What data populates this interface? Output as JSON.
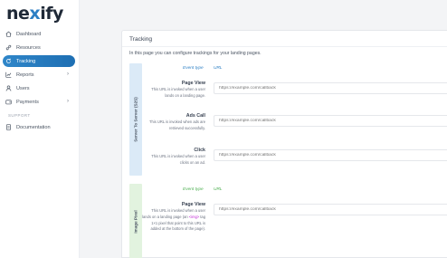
{
  "brand": {
    "logo_prefix": "ne",
    "logo_x": "x",
    "logo_suffix": "ify"
  },
  "sidebar": {
    "items": [
      {
        "label": "Dashboard",
        "icon": "home-icon"
      },
      {
        "label": "Resources",
        "icon": "link-icon"
      },
      {
        "label": "Tracking",
        "icon": "refresh-icon",
        "active": true
      },
      {
        "label": "Reports",
        "icon": "chart-icon",
        "has_children": true
      },
      {
        "label": "Users",
        "icon": "user-icon"
      },
      {
        "label": "Payments",
        "icon": "wallet-icon",
        "has_children": true
      }
    ],
    "support_heading": "SUPPORT",
    "support_items": [
      {
        "label": "Documentation",
        "icon": "document-icon"
      }
    ]
  },
  "main": {
    "title": "Tracking",
    "description": "In this page you can configure trackings for your landing pages.",
    "groups": [
      {
        "label": "Server To Server (S2S)",
        "color": "#dbeaf7",
        "header": {
          "event_type": "Event type",
          "url": "URL"
        },
        "rows": [
          {
            "title": "Page View",
            "description": "This URL is invoked when a user lands on a landing page.",
            "placeholder": "https://example.com/callback"
          },
          {
            "title": "Ads Call",
            "description": "This URL is invoked when ads are retrieved successfully.",
            "placeholder": "https://example.com/callback"
          },
          {
            "title": "Click",
            "description": "This URL is invoked when a user clicks on an ad.",
            "placeholder": "https://example.com/callback"
          }
        ]
      },
      {
        "label": "Image Pixel",
        "color": "#e2f3df",
        "header": {
          "event_type": "Event type",
          "url": "URL"
        },
        "rows": [
          {
            "title": "Page View",
            "description_before": "This URL is invoked when a user lands on a landing page (an ",
            "description_highlight": "<img>",
            "description_after": " tag 1×1 pixel that point to this URL is added at the bottom of the page).",
            "placeholder": "https://example.com/callback"
          }
        ]
      }
    ]
  }
}
